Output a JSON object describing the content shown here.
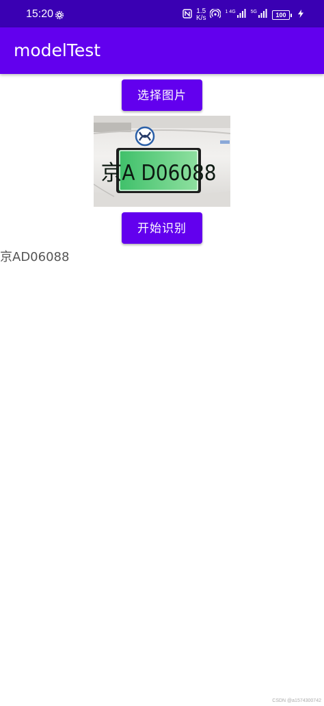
{
  "status_bar": {
    "time": "15:20",
    "speed_value": "1.5",
    "speed_unit": "K/s",
    "net_type": "1 4G",
    "net_type_2": "5G",
    "battery": "100",
    "bg_color": "#3a00b3"
  },
  "app_bar": {
    "title": "modelTest",
    "color": "#6200ee"
  },
  "main": {
    "select_button_label": "选择图片",
    "recognize_button_label": "开始识别",
    "plate_text": "京A D06088",
    "result_text": "京AD06088"
  },
  "icons": {
    "gear": "gear-icon",
    "nfc": "nfc-icon",
    "hotspot": "hotspot-icon",
    "signal": "signal-icon",
    "battery": "battery-icon",
    "bolt": "charging-bolt-icon"
  },
  "watermark": "CSDN @a1574300742"
}
